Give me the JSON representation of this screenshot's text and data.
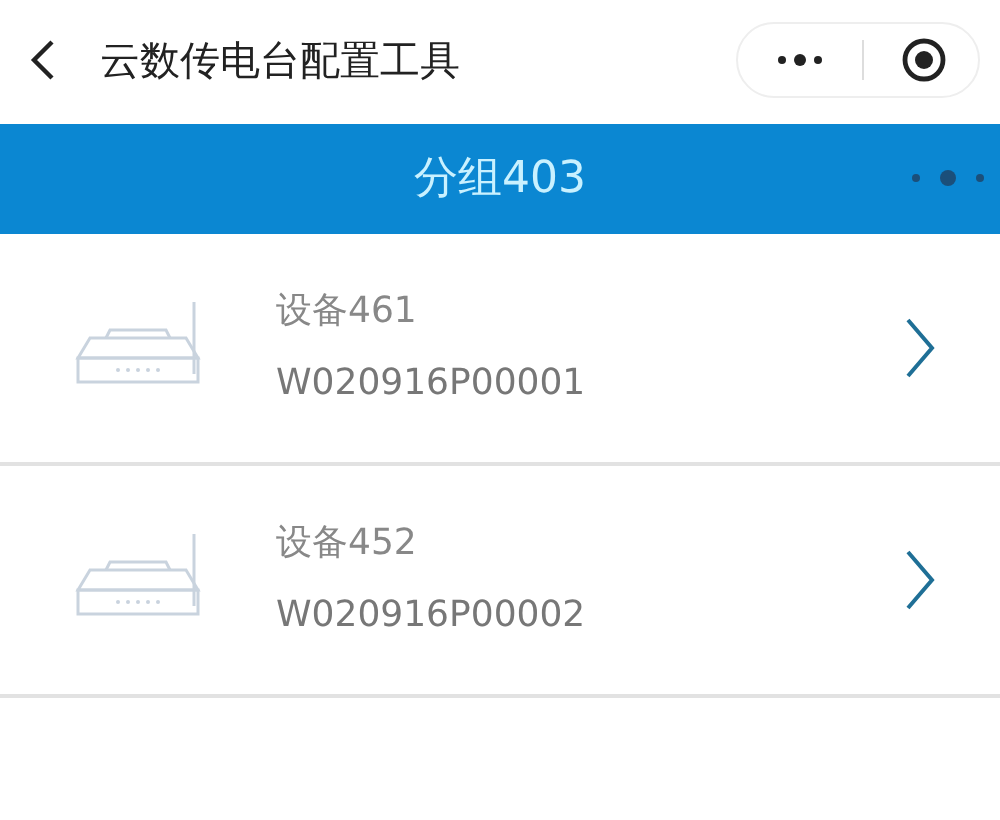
{
  "nav_bar": {
    "title": "云数传电台配置工具"
  },
  "group_header": {
    "title": "分组403"
  },
  "devices": [
    {
      "name": "设备461",
      "serial": "W020916P00001"
    },
    {
      "name": "设备452",
      "serial": "W020916P00002"
    }
  ]
}
